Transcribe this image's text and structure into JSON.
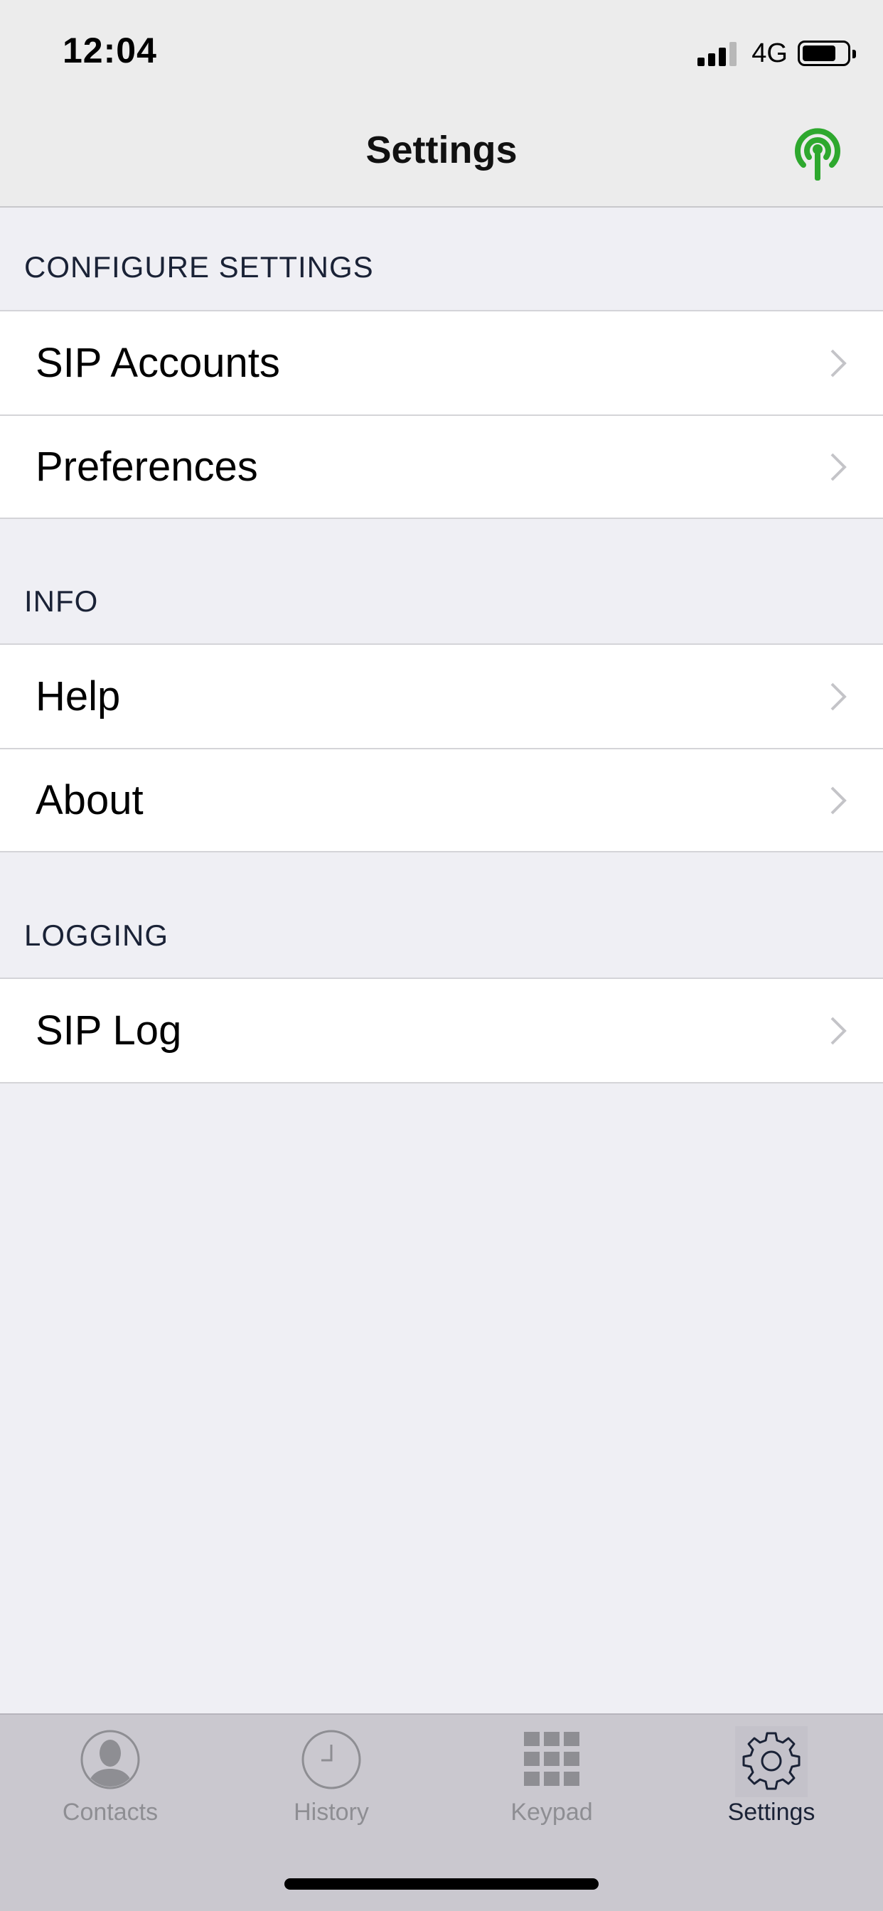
{
  "status_bar": {
    "time": "12:04",
    "network": "4G"
  },
  "nav": {
    "title": "Settings"
  },
  "sections": [
    {
      "header": "CONFIGURE SETTINGS",
      "rows": [
        "SIP Accounts",
        "Preferences"
      ]
    },
    {
      "header": "INFO",
      "rows": [
        "Help",
        "About"
      ]
    },
    {
      "header": "LOGGING",
      "rows": [
        "SIP Log"
      ]
    }
  ],
  "tabs": [
    {
      "label": "Contacts",
      "icon": "contacts-icon"
    },
    {
      "label": "History",
      "icon": "clock-icon"
    },
    {
      "label": "Keypad",
      "icon": "keypad-icon"
    },
    {
      "label": "Settings",
      "icon": "gear-icon",
      "active": true
    }
  ],
  "colors": {
    "accent_green": "#2ea82e",
    "tab_active": "#1a2236",
    "tab_inactive": "#8e8e93",
    "background": "#efeff4"
  }
}
